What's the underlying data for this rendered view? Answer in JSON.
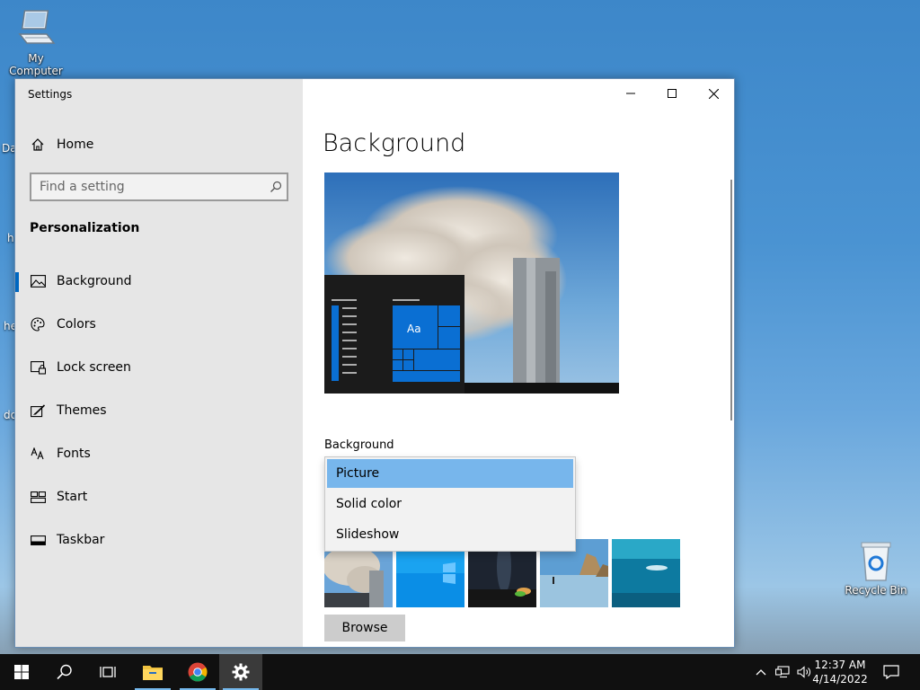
{
  "desktop": {
    "my_computer": "My Computer",
    "recycle_bin": "Recycle Bin",
    "partial_labels": [
      "Da",
      "h",
      "he",
      "do"
    ]
  },
  "window": {
    "title": "Settings",
    "controls": [
      "minimize-icon",
      "maximize-icon",
      "close-icon"
    ]
  },
  "sidebar": {
    "home": "Home",
    "search_placeholder": "Find a setting",
    "section": "Personalization",
    "items": [
      {
        "label": "Background",
        "icon": "image-icon",
        "active": true
      },
      {
        "label": "Colors",
        "icon": "palette-icon",
        "active": false
      },
      {
        "label": "Lock screen",
        "icon": "lock-screen-icon",
        "active": false
      },
      {
        "label": "Themes",
        "icon": "themes-icon",
        "active": false
      },
      {
        "label": "Fonts",
        "icon": "fonts-icon",
        "active": false
      },
      {
        "label": "Start",
        "icon": "start-icon",
        "active": false
      },
      {
        "label": "Taskbar",
        "icon": "taskbar-icon",
        "active": false
      }
    ]
  },
  "content": {
    "title": "Background",
    "preview_tile_text": "Aa",
    "background_label": "Background",
    "dropdown": {
      "selected": "Picture",
      "options": [
        "Picture",
        "Solid color",
        "Slideshow"
      ]
    },
    "thumbnails": [
      "smoke-photo",
      "windows-blue",
      "night-sky",
      "beach-rocks",
      "underwater"
    ],
    "browse_label": "Browse"
  },
  "taskbar": {
    "apps": [
      "start-icon",
      "search-icon",
      "task-view-icon",
      "file-explorer-icon",
      "chrome-icon",
      "settings-gear-icon"
    ],
    "time": "12:37 AM",
    "date": "4/14/2022"
  },
  "colors": {
    "accent": "#0067c0",
    "selection": "#77b6ec",
    "tile_blue": "#0a6fd3"
  }
}
